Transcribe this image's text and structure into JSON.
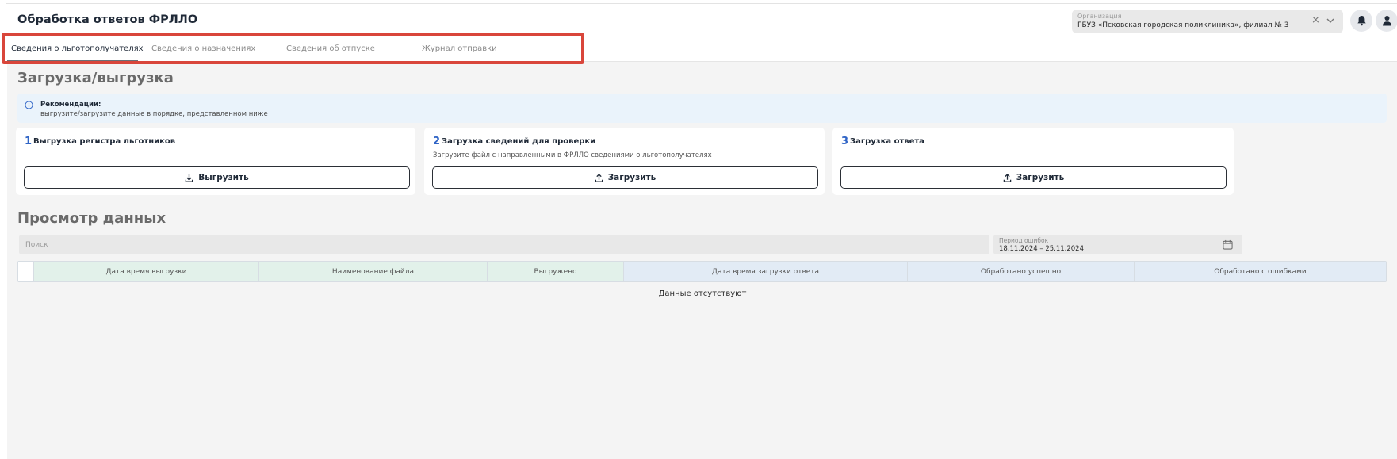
{
  "header": {
    "title": "Обработка ответов ФРЛЛО",
    "organization": {
      "label": "Организация",
      "value": "ГБУЗ «Псковская городская поликлиника», филиал № 3",
      "clear_glyph": "×"
    },
    "icons": [
      "bell-icon",
      "user-icon"
    ]
  },
  "tabs": [
    {
      "label": "Сведения о льготополучателях",
      "active": true
    },
    {
      "label": "Сведения о назначениях",
      "active": false
    },
    {
      "label": "Сведения об отпуске",
      "active": false
    },
    {
      "label": "Журнал отправки",
      "active": false
    }
  ],
  "upload_section": {
    "title": "Загрузка/выгрузка",
    "recommendation": {
      "title": "Рекомендации:",
      "text": "выгрузите/загрузите данные в порядке, представленном ниже"
    },
    "cards": [
      {
        "number": "1",
        "title": "Выгрузка регистра льготников",
        "description": "",
        "button_label": "Выгрузить",
        "button_icon": "download-icon"
      },
      {
        "number": "2",
        "title": "Загрузка сведений для проверки",
        "description": "Загрузите файл с направленными в ФРЛЛО сведениями о льготополучателях",
        "button_label": "Загрузить",
        "button_icon": "upload-icon"
      },
      {
        "number": "3",
        "title": "Загрузка ответа",
        "description": "",
        "button_label": "Загрузить",
        "button_icon": "upload-icon"
      }
    ]
  },
  "data_section": {
    "title": "Просмотр данных",
    "search": {
      "placeholder": "Поиск",
      "value": ""
    },
    "period": {
      "label": "Период ошибок",
      "value": "18.11.2024 – 25.11.2024"
    },
    "table": {
      "columns": [
        "Дата время выгрузки",
        "Наименование файла",
        "Выгружено",
        "Дата время загрузки ответа",
        "Обработано успешно",
        "Обработано с ошибками"
      ],
      "rows": [],
      "empty_text": "Данные отсутствуют"
    }
  },
  "colors": {
    "accent_number": "#2f64c6",
    "highlight_border": "#d9463b",
    "header_green": "#e2f1ea",
    "header_blue": "#e2ebf5"
  }
}
